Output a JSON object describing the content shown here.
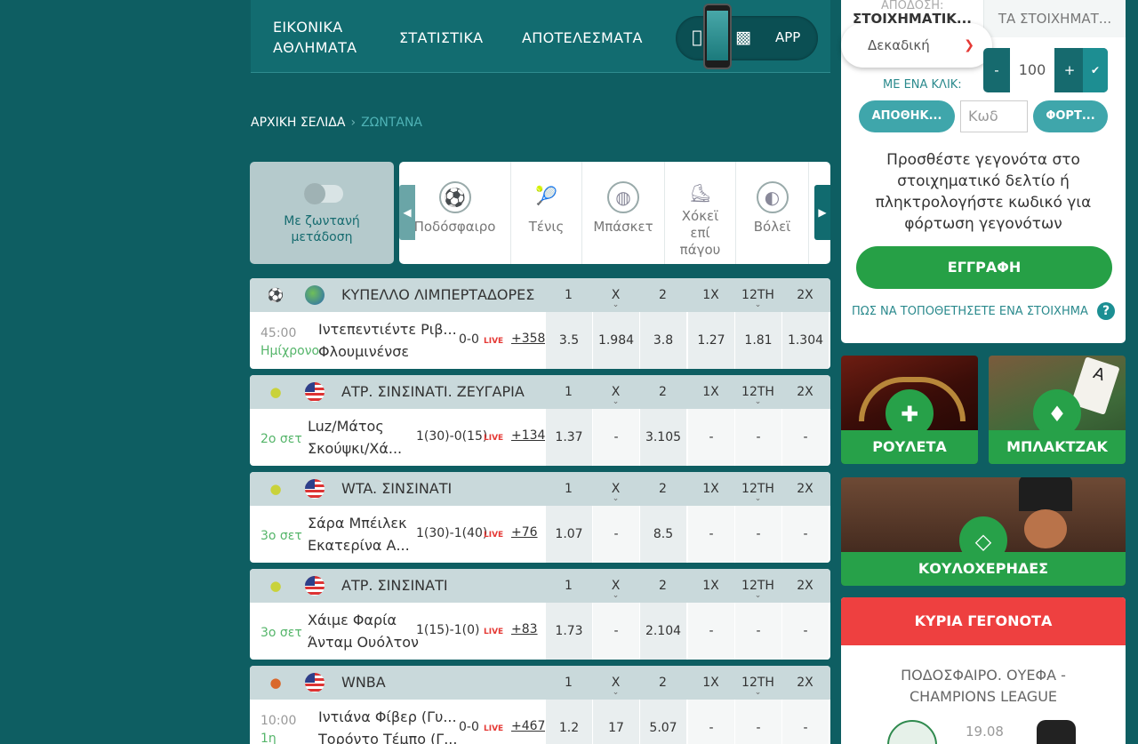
{
  "topnav": {
    "items": [
      "ΕΙΚΟΝΙΚΑ ΑΘΛΗΜΑΤΑ",
      "ΣΤΑΤΙΣΤΙΚΑ",
      "ΑΠΟΤΕΛΕΣΜΑΤΑ"
    ],
    "app_label": "APP"
  },
  "breadcrumb": {
    "home": "ΑΡΧΙΚΗ ΣΕΛΙΔΑ",
    "current": "ΖΩΝΤΑΝΑ"
  },
  "live_stream_label": "Με ζωντανή μετάδοση",
  "sports": [
    {
      "label": "Ποδόσφαιρο",
      "icon": "soccer-ball-icon"
    },
    {
      "label": "Τένις",
      "icon": "tennis-racket-icon"
    },
    {
      "label": "Μπάσκετ",
      "icon": "basketball-icon"
    },
    {
      "label": "Χόκεϊ επί πάγου",
      "icon": "hockey-stick-icon"
    },
    {
      "label": "Βόλεϊ",
      "icon": "volleyball-icon"
    }
  ],
  "market_headers": [
    "1",
    "X",
    "2",
    "1X",
    "12TH",
    "2X"
  ],
  "events": [
    {
      "title": "ΚΥΠΕΛΛΟ ΛΙΜΠΕΡΤΑΔΟΡΕΣ",
      "sport_icon": "soccer-ball-icon",
      "flag": "world-globe-icon",
      "time": "45:00",
      "period": "Ημίχρονο",
      "team1": "Ιντεπεντιέντε Ριβ...",
      "team2": "Φλουμινένσε",
      "score": "0-0",
      "live": "LIVE",
      "more": "+358",
      "odds": [
        "3.5",
        "1.984",
        "3.8",
        "1.27",
        "1.81",
        "1.304"
      ]
    },
    {
      "title": "ΑΤΡ. ΣΙΝΣΙΝΑΤΙ. ΖΕΥΓΑΡΙΑ",
      "sport_icon": "tennis-ball-icon",
      "flag": "usa-flag-icon",
      "time": "",
      "period": "2ο σετ",
      "team1": "Luz/Μάτος",
      "team2": "Σκούψκι/Χά...",
      "score": "1(30)-0(15)",
      "live": "LIVE",
      "more": "+134",
      "odds": [
        "1.37",
        "-",
        "3.105",
        "-",
        "-",
        "-"
      ]
    },
    {
      "title": "WTA. ΣΙΝΣΙΝΑΤΙ",
      "sport_icon": "tennis-ball-icon",
      "flag": "usa-flag-icon",
      "time": "",
      "period": "3ο σετ",
      "team1": "Σάρα Μπέιλεκ",
      "team2": "Εκατερίνα Α...",
      "score": "1(30)-1(40)",
      "live": "LIVE",
      "more": "+76",
      "odds": [
        "1.07",
        "-",
        "8.5",
        "-",
        "-",
        "-"
      ]
    },
    {
      "title": "ΑΤΡ. ΣΙΝΣΙΝΑΤΙ",
      "sport_icon": "tennis-ball-icon",
      "flag": "usa-flag-icon",
      "time": "",
      "period": "3ο σετ",
      "team1": "Χάιμε Φαρία",
      "team2": "Άνταμ Ουόλτον",
      "score": "1(15)-1(0)",
      "live": "LIVE",
      "more": "+83",
      "odds": [
        "1.73",
        "-",
        "2.104",
        "-",
        "-",
        "-"
      ]
    },
    {
      "title": "WNBA",
      "sport_icon": "basketball-icon",
      "flag": "usa-flag-icon",
      "time": "10:00",
      "period": "1η",
      "team1": "Ιντιάνα Φίβερ (Γυ...",
      "team2": "Τορόντο Τέμπο (Γ...",
      "score": "0-0",
      "live": "LIVE",
      "more": "+467",
      "odds": [
        "1.2",
        "17",
        "5.07",
        "-",
        "-",
        "-"
      ]
    }
  ],
  "betslip": {
    "tab_top": "ΑΠΟΔΟΣΗ:",
    "tab1": "ΣΤΟΙΧΗΜΑΤΙΚ...",
    "tab2": "ΤΑ ΣΤΟΙΧΗΜΑΤ...",
    "odds_format": "Δεκαδική",
    "stake_minus": "-",
    "stake_value": "100",
    "stake_plus": "+",
    "one_click": "ΜΕ ΕΝΑ ΚΛΙΚ:",
    "save_label": "ΑΠΟΘΗΚ...",
    "code_placeholder": "Κωδ",
    "load_label": "ΦΟΡΤ...",
    "hint": "Προσθέστε γεγονότα στο στοιχηματικό δελτίο ή πληκτρολογήστε κωδικό για φόρτωση γεγονότων",
    "register": "ΕΓΓΡΑΦΗ",
    "how_to": "ΠΩΣ ΝΑ ΤΟΠΟΘΕΤΗΣΕΤΕ ΕΝΑ ΣΤΟΙΧΗΜΑ",
    "help": "?"
  },
  "promos": {
    "roulette": "ΡΟΥΛΕΤΑ",
    "blackjack": "ΜΠΛΑΚΤΖΑΚ",
    "leprechauns": "ΚΟΥΛΟΧΕΡΗΔΕΣ"
  },
  "featured": {
    "header": "ΚΥΡΙΑ ΓΕΓΟΝΟΤΑ",
    "league": "ΠΟΔΟΣΦΑΙΡΟ. ΟΥΕΦΑ - CHAMPIONS LEAGUE",
    "date": "19.08"
  },
  "colors": {
    "background": "#0e5e62",
    "accent": "#27a149",
    "live": "#e53935",
    "header_red": "#ee4040"
  }
}
